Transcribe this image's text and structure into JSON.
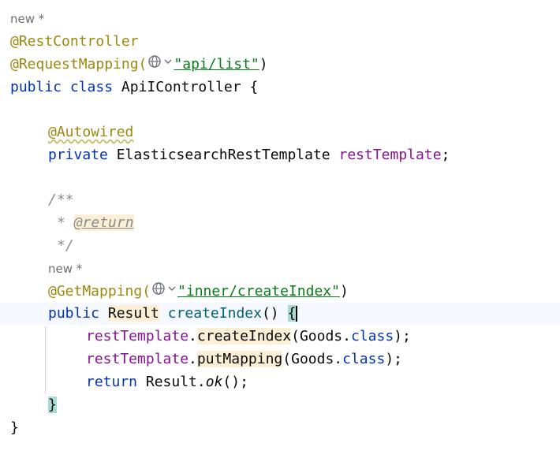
{
  "hints": {
    "author_hint_1": "new *",
    "author_hint_2": "new *"
  },
  "code": {
    "ann_rest_controller": "@RestController",
    "ann_request_mapping": "@RequestMapping(",
    "request_mapping_value": "\"api/list\"",
    "paren_close": ")",
    "kw_public_class": "public class",
    "class_name": "ApiIController",
    "brace_open": "{",
    "ann_autowired": "@Autowired",
    "kw_private": "private",
    "field_type": "ElasticsearchRestTemplate",
    "field_name": "restTemplate",
    "semicolon": ";",
    "doc_open": "/**",
    "doc_star": "*",
    "doc_return_tag": "@return",
    "doc_close": "*/",
    "ann_get_mapping": "@GetMapping(",
    "get_mapping_value": "\"inner/createIndex\"",
    "kw_public": "public",
    "return_type": "Result",
    "method_name": "createIndex",
    "method_parens": "()",
    "call1_target": "restTemplate",
    "dot": ".",
    "call1_method": "createIndex",
    "call_arg_open": "(Goods.",
    "kw_class": "class",
    "call_close": ");",
    "call2_target": "restTemplate",
    "call2_method": "putMapping",
    "kw_return": "return",
    "return_expr_prefix": "Result.",
    "return_method": "ok",
    "return_call_close": "();",
    "method_brace_close": "}",
    "class_brace_close": "}"
  },
  "colors": {
    "keyword": "#0033b3",
    "annotation": "#9e880d",
    "string": "#067d17",
    "field": "#871094",
    "comment": "#8c8c8c",
    "method": "#00627a",
    "caret_line": "#f5f8fe",
    "brace_match": "#a6dad5",
    "usage_highlight": "#fbf0d5"
  },
  "icons": {
    "url_mapping_icon": "globe-icon",
    "dropdown_icon": "chevron-down-icon"
  }
}
